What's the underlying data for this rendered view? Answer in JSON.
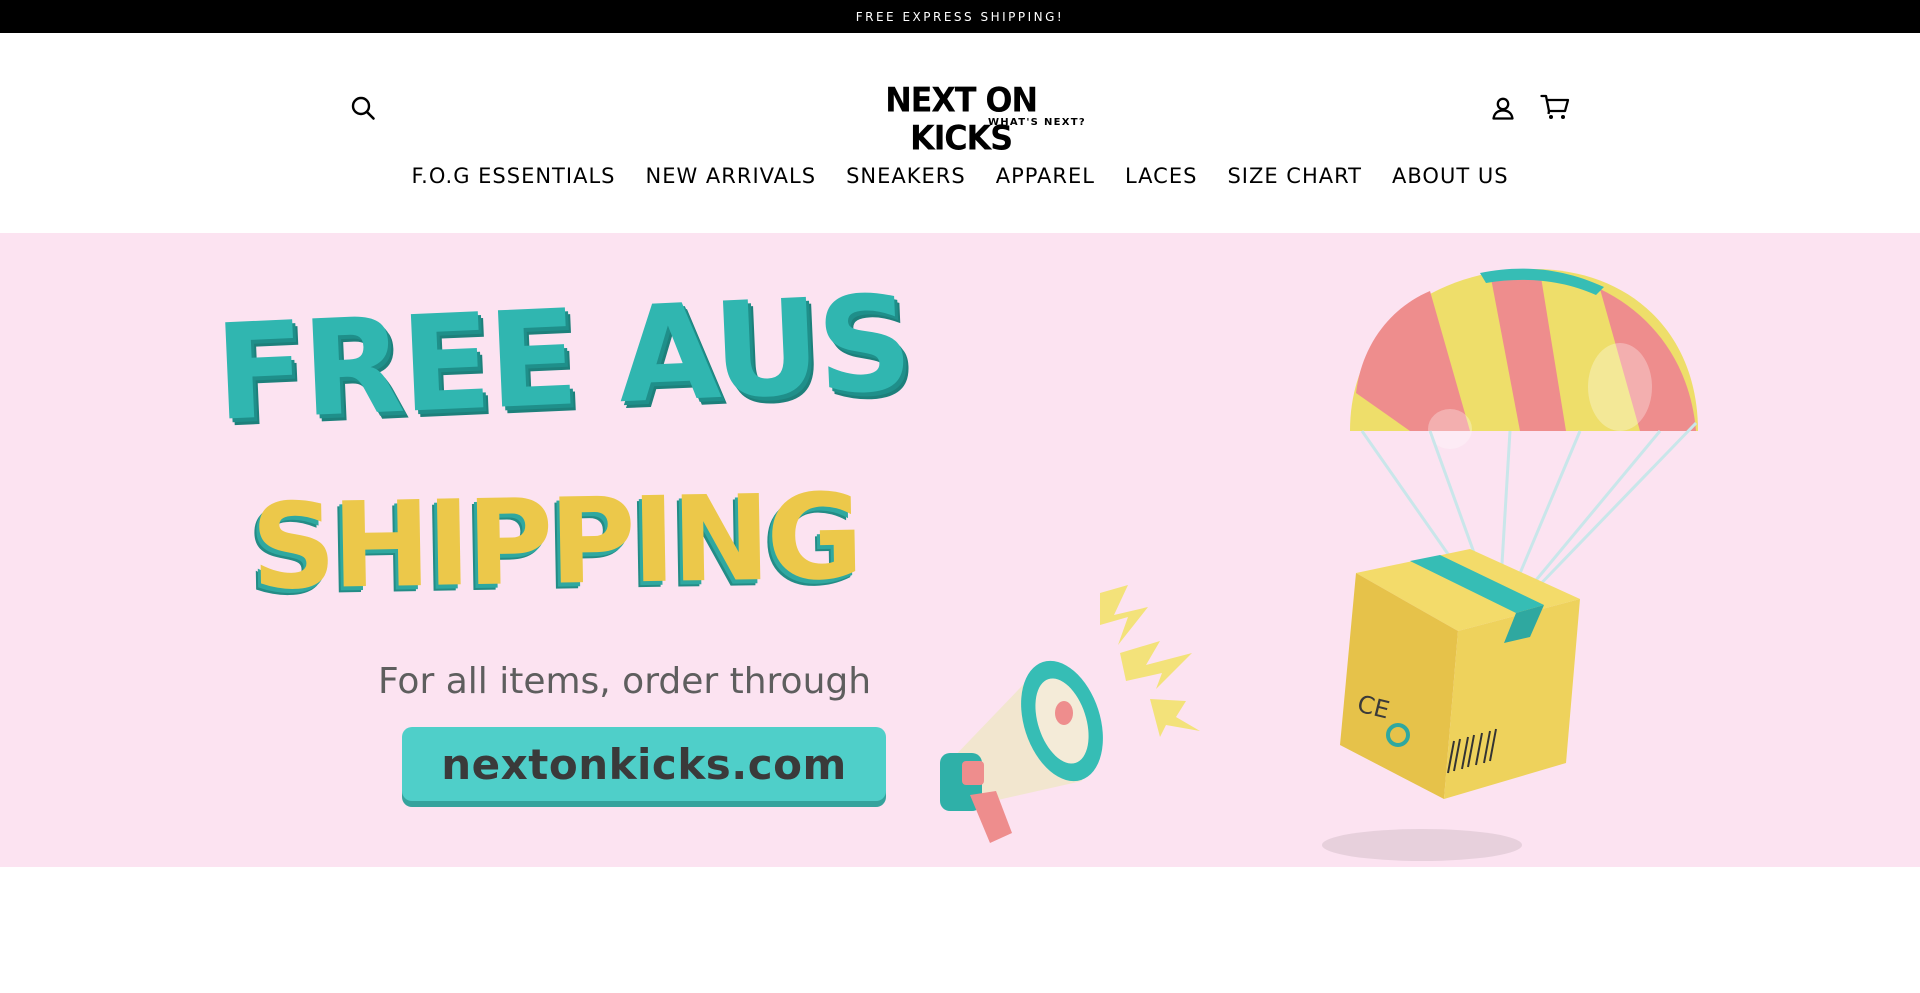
{
  "announcement": {
    "text": "FREE EXPRESS SHIPPING!"
  },
  "header": {
    "logo": {
      "title": "NEXT ON KICKS",
      "tagline": "WHAT'S NEXT?"
    },
    "icons": {
      "search": "search-icon",
      "account": "user-icon",
      "cart": "cart-icon"
    }
  },
  "nav": {
    "items": [
      {
        "label": "F.O.G ESSENTIALS"
      },
      {
        "label": "NEW ARRIVALS"
      },
      {
        "label": "SNEAKERS"
      },
      {
        "label": "APPAREL"
      },
      {
        "label": "LACES"
      },
      {
        "label": "SIZE CHART"
      },
      {
        "label": "ABOUT US"
      }
    ]
  },
  "hero": {
    "headline_line1": "FREE AUS",
    "headline_line2": "SHIPPING",
    "subline": "For all items, order through",
    "url_button": "nextonkicks.com",
    "box_mark": "CE",
    "colors": {
      "background": "#fce3f1",
      "teal": "#30b6b0",
      "yellow": "#ecc84a",
      "pink": "#ee8d8d",
      "button": "#4fcfc9"
    }
  }
}
